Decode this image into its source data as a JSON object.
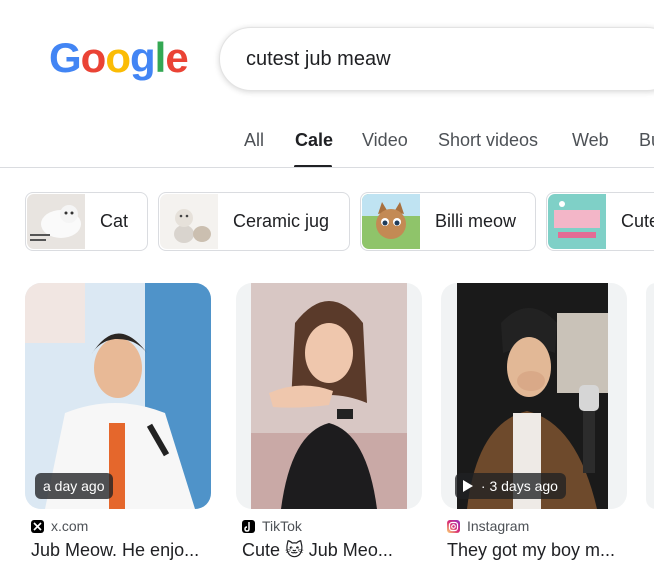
{
  "logo": {
    "letters": [
      "G",
      "o",
      "o",
      "g",
      "l",
      "e"
    ],
    "colors": [
      "#4285F4",
      "#EA4335",
      "#FBBC05",
      "#4285F4",
      "#34A853",
      "#EA4335"
    ]
  },
  "search": {
    "value": "cutest jub meaw"
  },
  "tabs": [
    {
      "label": "All",
      "active": false
    },
    {
      "label": "Cale",
      "active": true
    },
    {
      "label": "Video",
      "active": false
    },
    {
      "label": "Short videos",
      "active": false
    },
    {
      "label": "Web",
      "active": false
    },
    {
      "label": "Bu",
      "active": false
    }
  ],
  "chips": [
    {
      "label": "Cat",
      "thumb": "white-cat-photo"
    },
    {
      "label": "Ceramic jug",
      "thumb": "ceramic-jug-photo"
    },
    {
      "label": "Billi meow",
      "thumb": "cartoon-cat-photo"
    },
    {
      "label": "Cute",
      "thumb": "meow-text-photo"
    }
  ],
  "results": [
    {
      "time": "a day ago",
      "has_play": false,
      "source": "x.com",
      "source_icon": "x-logo-icon",
      "title": "Jub Meow. He enjo..."
    },
    {
      "time": "",
      "has_play": false,
      "source": "TikTok",
      "source_icon": "tiktok-icon",
      "title": "Cute 🐱 Jub Meo..."
    },
    {
      "time": "3 days ago",
      "has_play": true,
      "source": "Instagram",
      "source_icon": "instagram-icon",
      "title": "They got my boy m..."
    }
  ],
  "colors": {
    "accent": "#202124",
    "muted": "#4d5156",
    "border": "#dadce0"
  }
}
